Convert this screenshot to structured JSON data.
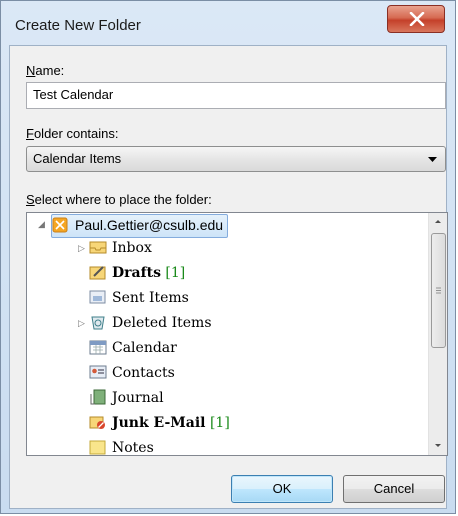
{
  "window": {
    "title": "Create New Folder"
  },
  "name_field": {
    "label_accel": "N",
    "label_rest": "ame:",
    "value": "Test Calendar"
  },
  "folder_contains": {
    "label_accel": "F",
    "label_rest": "older contains:",
    "selected": "Calendar Items"
  },
  "location": {
    "label_accel": "S",
    "label_rest": "elect where to place the folder:",
    "root": "Paul.Gettier@csulb.edu",
    "items": [
      {
        "label": "Inbox",
        "icon": "inbox-icon",
        "bold": false,
        "count": ""
      },
      {
        "label": "Drafts",
        "icon": "drafts-icon",
        "bold": true,
        "count": "[1]"
      },
      {
        "label": "Sent Items",
        "icon": "sent-items-icon",
        "bold": false,
        "count": ""
      },
      {
        "label": "Deleted Items",
        "icon": "deleted-items-icon",
        "bold": false,
        "count": ""
      },
      {
        "label": "Calendar",
        "icon": "calendar-icon",
        "bold": false,
        "count": ""
      },
      {
        "label": "Contacts",
        "icon": "contacts-icon",
        "bold": false,
        "count": ""
      },
      {
        "label": "Journal",
        "icon": "journal-icon",
        "bold": false,
        "count": ""
      },
      {
        "label": "Junk E-Mail",
        "icon": "junk-email-icon",
        "bold": true,
        "count": "[1]"
      },
      {
        "label": "Notes",
        "icon": "notes-icon",
        "bold": false,
        "count": ""
      }
    ]
  },
  "buttons": {
    "ok": "OK",
    "cancel": "Cancel"
  },
  "colors": {
    "count_green": "#1a8a1a",
    "close_red": "#c4402a"
  }
}
